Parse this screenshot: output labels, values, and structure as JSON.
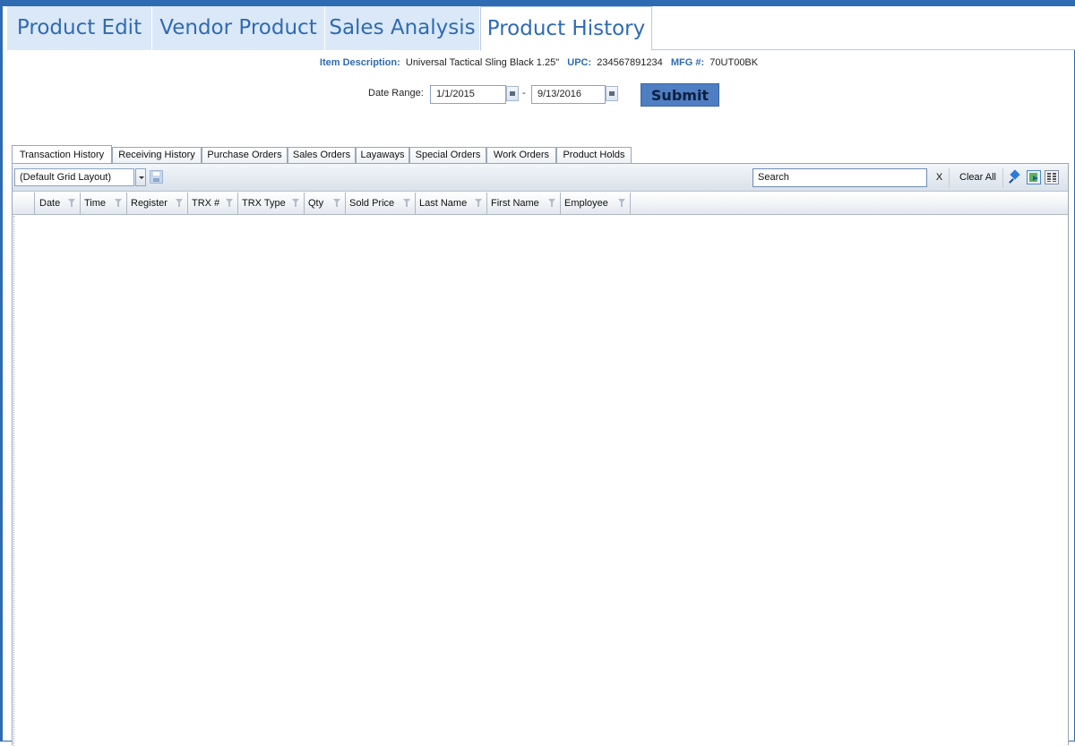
{
  "main_tabs": [
    {
      "label": "Product Edit",
      "active": false
    },
    {
      "label": "Vendor Product",
      "active": false
    },
    {
      "label": "Sales Analysis",
      "active": false
    },
    {
      "label": "Product History",
      "active": true
    }
  ],
  "item_info": {
    "description_label": "Item Description:",
    "description_value": "Universal Tactical Sling Black 1.25\"",
    "upc_label": "UPC:",
    "upc_value": "234567891234",
    "mfg_label": "MFG #:",
    "mfg_value": "70UT00BK"
  },
  "date_range": {
    "label": "Date Range:",
    "start": "1/1/2015",
    "separator": "-",
    "end": "9/13/2016",
    "submit_label": "Submit"
  },
  "sub_tabs": [
    {
      "label": "Transaction History",
      "active": true
    },
    {
      "label": "Receiving History",
      "active": false
    },
    {
      "label": "Purchase Orders",
      "active": false
    },
    {
      "label": "Sales Orders",
      "active": false
    },
    {
      "label": "Layaways",
      "active": false
    },
    {
      "label": "Special Orders",
      "active": false
    },
    {
      "label": "Work Orders",
      "active": false
    },
    {
      "label": "Product Holds",
      "active": false
    }
  ],
  "toolbar": {
    "layout_value": "(Default Grid Layout)",
    "search_value": "Search",
    "clear_x_label": "X",
    "clear_all_label": "Clear All",
    "icons": [
      "save-layout-icon",
      "pin-icon",
      "export-icon",
      "column-chooser-icon"
    ]
  },
  "grid": {
    "columns": [
      "Date",
      "Time",
      "Register",
      "TRX #",
      "TRX Type",
      "Qty",
      "Sold Price",
      "Last Name",
      "First Name",
      "Employee"
    ],
    "rows": []
  },
  "colors": {
    "accent": "#2f6bb3",
    "tab_inactive": "#dbe8f7",
    "submit_button": "#4f7ec2"
  }
}
